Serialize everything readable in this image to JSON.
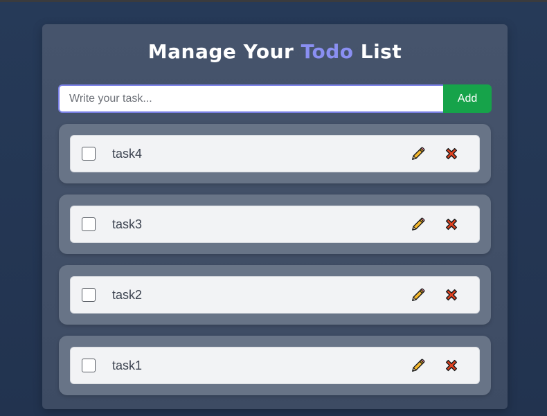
{
  "app": {
    "title_part1": "Manage Your",
    "title_accent": "Todo",
    "title_part2": "List",
    "accent_color": "#8a8ff2"
  },
  "input": {
    "value": "",
    "placeholder": "Write your task..."
  },
  "add_button": {
    "label": "Add",
    "color": "#16a34a"
  },
  "todos": [
    {
      "text": "task4",
      "checked": false,
      "edit_icon": "pencil-icon",
      "delete_icon": "cross-icon"
    },
    {
      "text": "task3",
      "checked": false,
      "edit_icon": "pencil-icon",
      "delete_icon": "cross-icon"
    },
    {
      "text": "task2",
      "checked": false,
      "edit_icon": "pencil-icon",
      "delete_icon": "cross-icon"
    },
    {
      "text": "task1",
      "checked": false,
      "edit_icon": "pencil-icon",
      "delete_icon": "cross-icon"
    }
  ]
}
